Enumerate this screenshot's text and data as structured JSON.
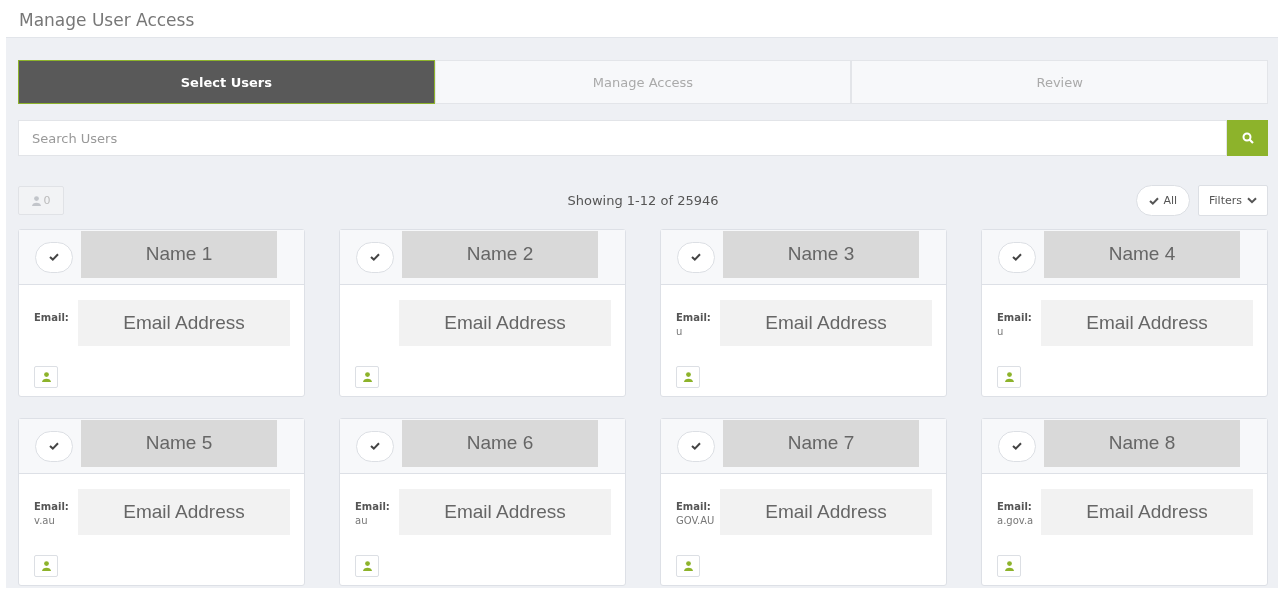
{
  "page": {
    "title": "Manage User Access"
  },
  "steps": [
    {
      "label": "Select Users",
      "selected": true
    },
    {
      "label": "Manage Access",
      "selected": false
    },
    {
      "label": "Review",
      "selected": false
    }
  ],
  "search": {
    "placeholder": "Search Users"
  },
  "toolbar": {
    "selected_count": "0",
    "showing": "Showing 1-12 of 25946",
    "all_button": "All",
    "filters_button": "Filters"
  },
  "cards": [
    {
      "name": "Name 1",
      "email_label": "Email:",
      "email": "Email Address"
    },
    {
      "name": "Name 2",
      "email": "Email Address"
    },
    {
      "name": "Name 3",
      "email_label": "Email:",
      "email_fragment": "u",
      "email": "Email Address"
    },
    {
      "name": "Name 4",
      "email_label": "Email:",
      "email_fragment": "u",
      "email": "Email Address"
    },
    {
      "name": "Name 5",
      "email_label": "Email:",
      "email_fragment": "v.au",
      "email": "Email Address"
    },
    {
      "name": "Name 6",
      "email_label": "Email:",
      "email_fragment": "au",
      "email": "Email Address"
    },
    {
      "name": "Name 7",
      "email_label": "Email:",
      "email_fragment": "GOV.AU",
      "email": "Email Address"
    },
    {
      "name": "Name 8",
      "email_label": "Email:",
      "email_fragment": "a.gov.a",
      "email": "Email Address"
    }
  ]
}
